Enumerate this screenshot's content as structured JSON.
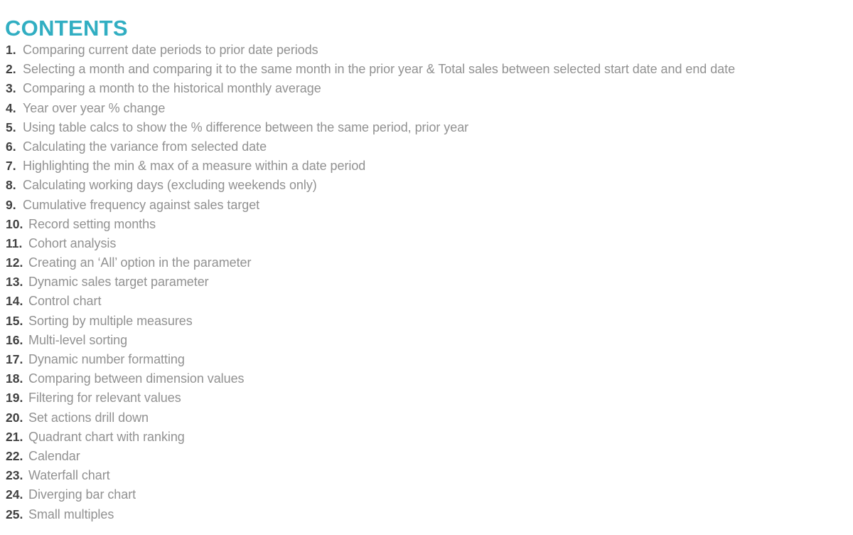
{
  "document": {
    "title": "CONTENTS",
    "title_color": "#31aec2",
    "background_color": "#ffffff",
    "number_color": "#3f3f3f",
    "text_color": "#919191"
  },
  "contents": [
    {
      "number": "1.",
      "label": "Comparing current date periods to prior date periods"
    },
    {
      "number": "2.",
      "label": "Selecting a month and comparing it to the same month in the prior year & Total sales between selected start date and end date"
    },
    {
      "number": "3.",
      "label": "Comparing a month to the historical monthly average"
    },
    {
      "number": "4.",
      "label": "Year over year % change"
    },
    {
      "number": "5.",
      "label": "Using table calcs to show the % difference between the same period, prior year"
    },
    {
      "number": "6.",
      "label": "Calculating the variance from selected date"
    },
    {
      "number": "7.",
      "label": "Highlighting the min & max of a measure within a date period"
    },
    {
      "number": "8.",
      "label": "Calculating working days (excluding weekends only)"
    },
    {
      "number": "9.",
      "label": "Cumulative frequency against sales target"
    },
    {
      "number": "10.",
      "label": "Record setting months"
    },
    {
      "number": "11.",
      "label": "Cohort analysis"
    },
    {
      "number": "12.",
      "label": "Creating an ‘All’ option in the parameter"
    },
    {
      "number": "13.",
      "label": "Dynamic sales target parameter"
    },
    {
      "number": "14.",
      "label": "Control chart"
    },
    {
      "number": "15.",
      "label": "Sorting by multiple measures"
    },
    {
      "number": "16.",
      "label": "Multi-level sorting"
    },
    {
      "number": "17.",
      "label": "Dynamic number formatting"
    },
    {
      "number": "18.",
      "label": "Comparing between dimension values"
    },
    {
      "number": "19.",
      "label": "Filtering for relevant values"
    },
    {
      "number": "20.",
      "label": "Set actions drill down"
    },
    {
      "number": "21.",
      "label": "Quadrant chart with ranking"
    },
    {
      "number": "22.",
      "label": "Calendar"
    },
    {
      "number": "23.",
      "label": "Waterfall chart"
    },
    {
      "number": "24.",
      "label": "Diverging bar chart"
    },
    {
      "number": "25.",
      "label": "Small multiples"
    }
  ]
}
